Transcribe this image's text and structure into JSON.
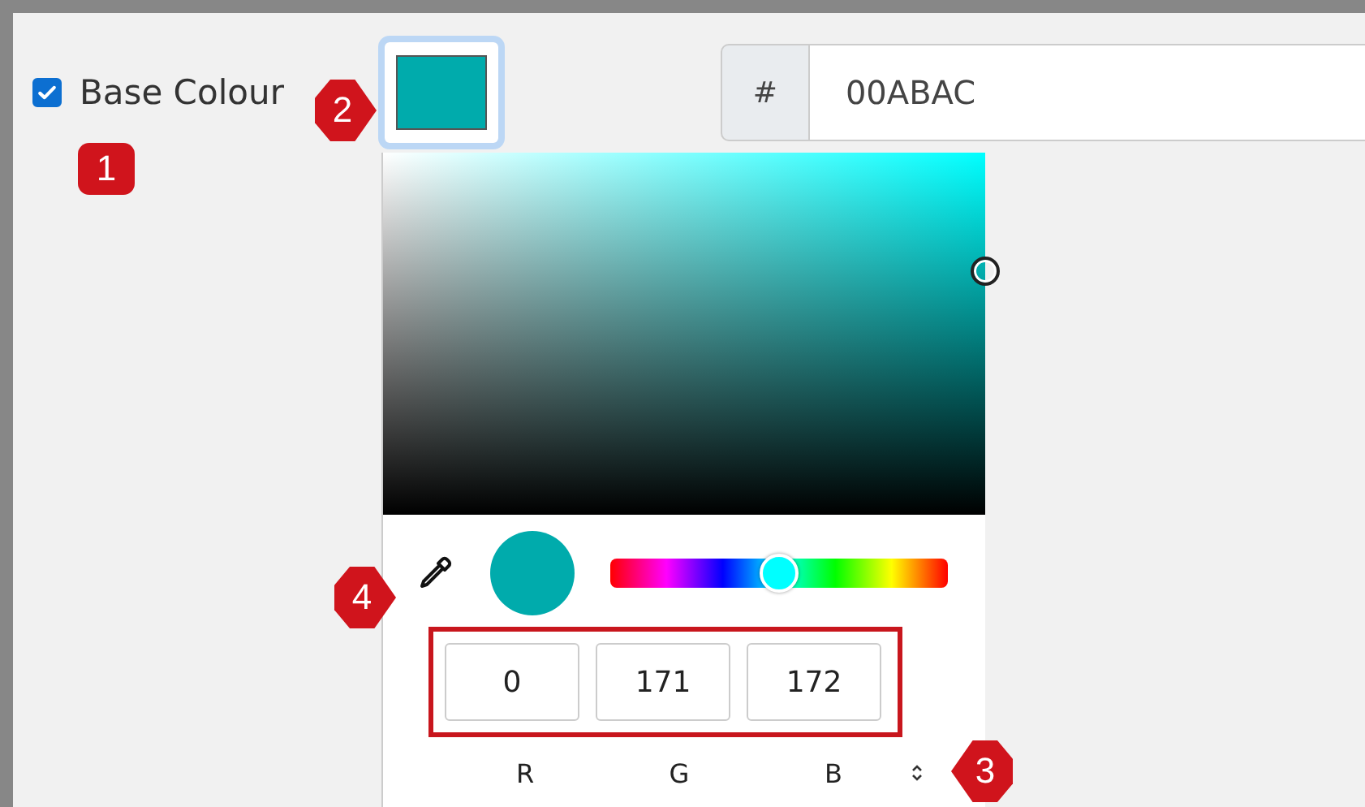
{
  "base_colour": {
    "label": "Base Colour",
    "checked": true
  },
  "hex": {
    "prefix": "#",
    "value": "00ABAC"
  },
  "picker": {
    "hue": {
      "level": 0.5
    },
    "channels": [
      {
        "value": "0",
        "label": "R"
      },
      {
        "value": "171",
        "label": "G"
      },
      {
        "value": "172",
        "label": "B"
      }
    ]
  },
  "annotations": [
    {
      "number": "1",
      "kind": "square"
    },
    {
      "number": "2",
      "kind": "point-right"
    },
    {
      "number": "3",
      "kind": "point-left"
    },
    {
      "number": "4",
      "kind": "point-right"
    }
  ]
}
